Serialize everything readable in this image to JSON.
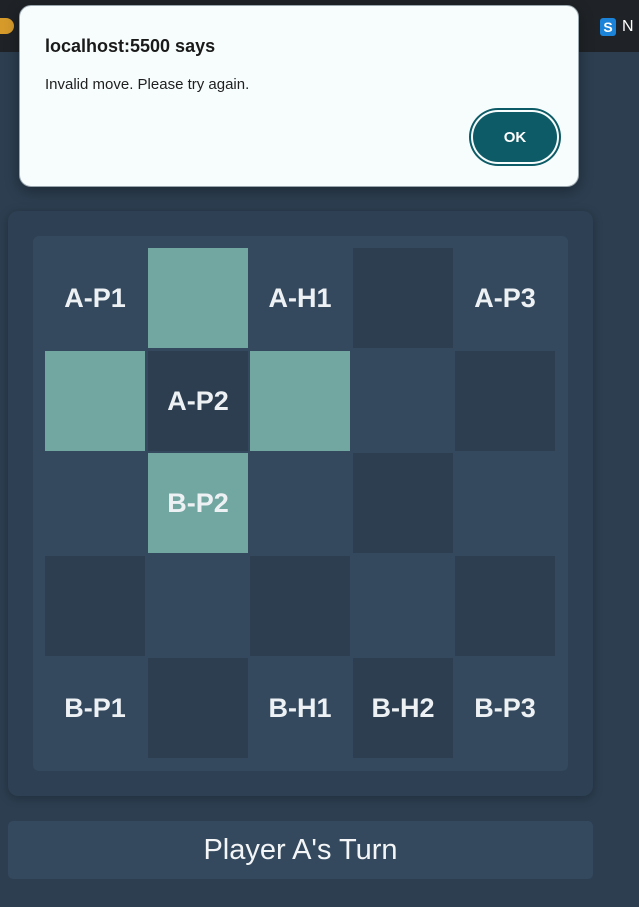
{
  "browser": {
    "right_tab_letter": "N",
    "right_tab_badge": "S",
    "left_icon": "browser-tab-favicon"
  },
  "dialog": {
    "title": "localhost:5500 says",
    "message": "Invalid move. Please try again.",
    "ok_label": "OK"
  },
  "board": {
    "rows": [
      [
        {
          "label": "A-P1",
          "shade": "light"
        },
        {
          "label": "",
          "shade": "highlight"
        },
        {
          "label": "A-H1",
          "shade": "light"
        },
        {
          "label": "",
          "shade": "dark"
        },
        {
          "label": "A-P3",
          "shade": "light"
        }
      ],
      [
        {
          "label": "",
          "shade": "highlight"
        },
        {
          "label": "A-P2",
          "shade": "dark"
        },
        {
          "label": "",
          "shade": "highlight"
        },
        {
          "label": "",
          "shade": "light"
        },
        {
          "label": "",
          "shade": "dark"
        }
      ],
      [
        {
          "label": "",
          "shade": "light"
        },
        {
          "label": "B-P2",
          "shade": "highlight"
        },
        {
          "label": "",
          "shade": "light"
        },
        {
          "label": "",
          "shade": "dark"
        },
        {
          "label": "",
          "shade": "light"
        }
      ],
      [
        {
          "label": "",
          "shade": "dark"
        },
        {
          "label": "",
          "shade": "light"
        },
        {
          "label": "",
          "shade": "dark"
        },
        {
          "label": "",
          "shade": "light"
        },
        {
          "label": "",
          "shade": "dark"
        }
      ],
      [
        {
          "label": "B-P1",
          "shade": "light"
        },
        {
          "label": "",
          "shade": "dark"
        },
        {
          "label": "B-H1",
          "shade": "light"
        },
        {
          "label": "B-H2",
          "shade": "dark"
        },
        {
          "label": "B-P3",
          "shade": "light"
        }
      ]
    ]
  },
  "status": {
    "turn_text": "Player A's Turn"
  },
  "colors": {
    "background": "#2c3e50",
    "board": "#34495e",
    "highlight": "#72a6a0",
    "ok_button": "#0d5b66"
  }
}
